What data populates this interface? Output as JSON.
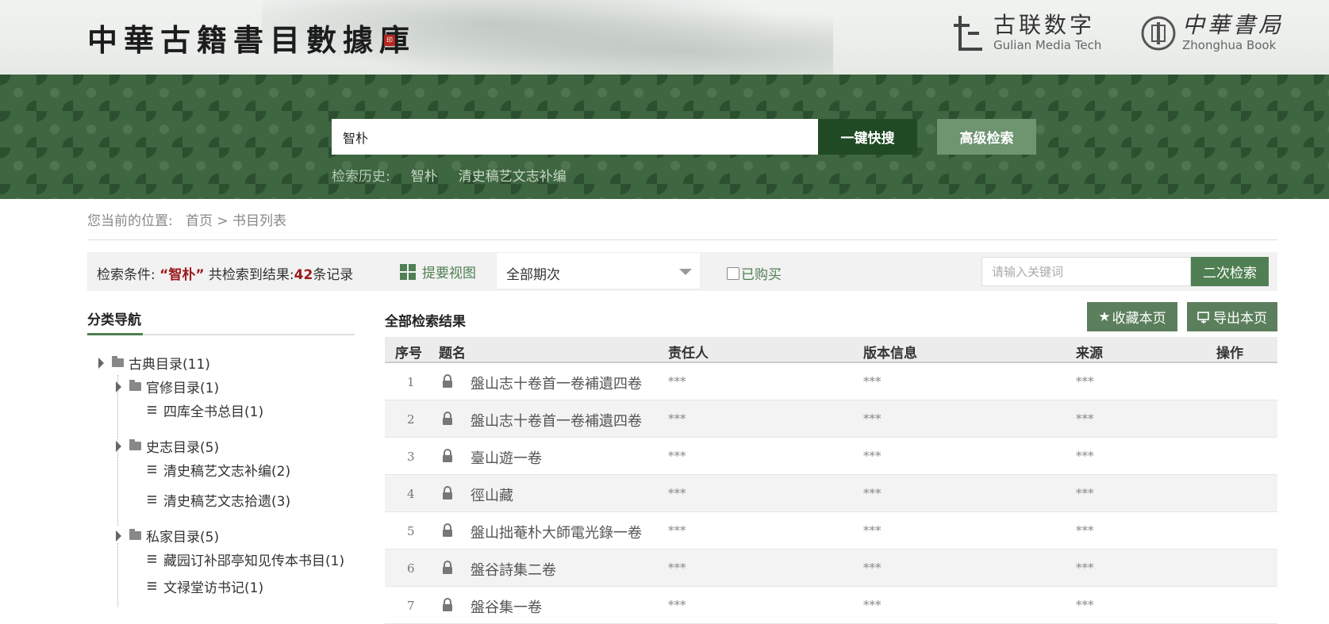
{
  "header": {
    "site_title": "中華古籍書目數據庫",
    "seal_text": "印",
    "gulian_cn": "古联数字",
    "gulian_en": "Gulian Media Tech",
    "zhonghua_cn": "中華書局",
    "zhonghua_en": "Zhonghua Book"
  },
  "search": {
    "query": "智朴",
    "quick_button": "一键快搜",
    "advanced_button": "高级检索",
    "history_label": "检索历史:",
    "history": [
      "智朴",
      "清史稿艺文志补编"
    ]
  },
  "breadcrumb": {
    "label": "您当前的位置:",
    "home": "首页",
    "separator": ">",
    "current": "书目列表"
  },
  "conditions": {
    "label": "检索条件:",
    "keyword": "“智朴”",
    "found_text": "共检索到结果:",
    "count": "42",
    "unit": "条记录",
    "view_label": "提要视图",
    "period_select": "全部期次",
    "purchased_label": "已购买",
    "keyword_placeholder": "请输入关键词",
    "second_search_button": "二次检索"
  },
  "sidebar": {
    "title": "分类导航",
    "tree": {
      "classic": "古典目录(11)",
      "official": "官修目录(1)",
      "siku": "四库全书总目(1)",
      "history": "史志目录(5)",
      "qingshi_bubian": "清史稿艺文志补编(2)",
      "qingshi_shiyi": "清史稿艺文志拾遗(3)",
      "private": "私家目录(5)",
      "cangyuan": "藏园订补郘亭知见传本书目(1)",
      "wenlu": "文禄堂访书记(1)"
    }
  },
  "results": {
    "title": "全部检索结果",
    "favorite_button": "收藏本页",
    "export_button": "导出本页",
    "columns": {
      "index": "序号",
      "title": "题名",
      "author": "责任人",
      "edition": "版本信息",
      "source": "来源",
      "action": "操作"
    },
    "rows": [
      {
        "index": "1",
        "title": "盤山志十卷首一卷補遺四卷",
        "author": "***",
        "edition": "***",
        "source": "***"
      },
      {
        "index": "2",
        "title": "盤山志十卷首一卷補遺四卷",
        "author": "***",
        "edition": "***",
        "source": "***"
      },
      {
        "index": "3",
        "title": "臺山遊一卷",
        "author": "***",
        "edition": "***",
        "source": "***"
      },
      {
        "index": "4",
        "title": "徑山藏",
        "author": "***",
        "edition": "***",
        "source": "***"
      },
      {
        "index": "5",
        "title": "盤山拙菴朴大師電光錄一卷",
        "author": "***",
        "edition": "***",
        "source": "***"
      },
      {
        "index": "6",
        "title": "盤谷詩集二卷",
        "author": "***",
        "edition": "***",
        "source": "***"
      },
      {
        "index": "7",
        "title": "盤谷集一卷",
        "author": "***",
        "edition": "***",
        "source": "***"
      }
    ]
  },
  "colors": {
    "brand_green": "#4f7f52",
    "dark_green": "#1f4a24",
    "accent_red": "#9b1a1a"
  }
}
